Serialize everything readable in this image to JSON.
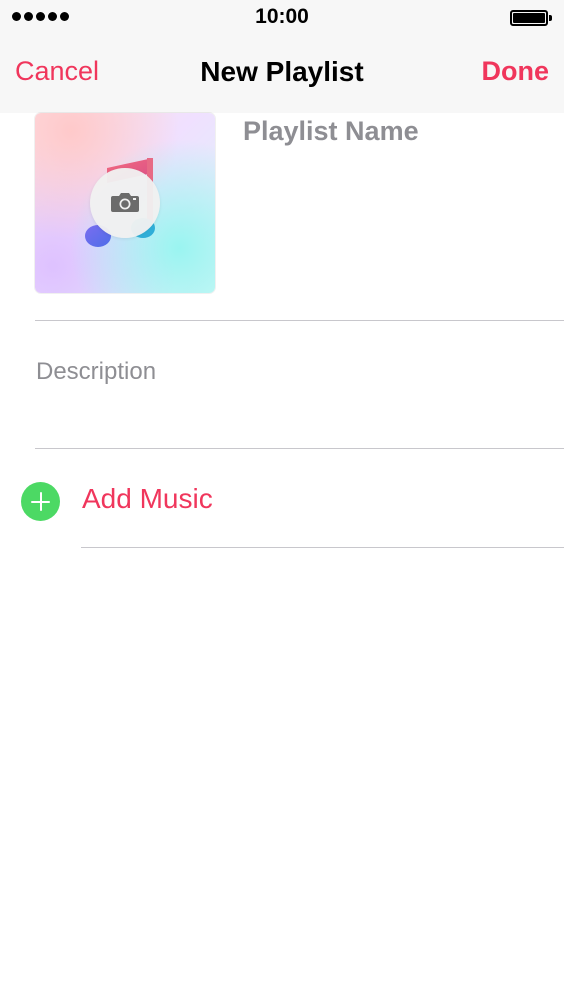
{
  "status_bar": {
    "time": "10:00",
    "icons": [
      "signal-dots-icon",
      "battery-icon"
    ]
  },
  "nav": {
    "cancel_label": "Cancel",
    "title": "New Playlist",
    "done_label": "Done"
  },
  "artwork": {
    "icons": [
      "music-note-icon",
      "camera-icon"
    ]
  },
  "form": {
    "name_placeholder": "Playlist Name",
    "description_placeholder": "Description"
  },
  "add_music": {
    "label": "Add Music",
    "icon": "plus-circle-icon"
  },
  "colors": {
    "accent": "#f0365c",
    "add_green": "#4cd964",
    "placeholder_gray": "#8e8e93",
    "separator": "#c8c7cc",
    "bar_background": "#f7f7f7"
  }
}
